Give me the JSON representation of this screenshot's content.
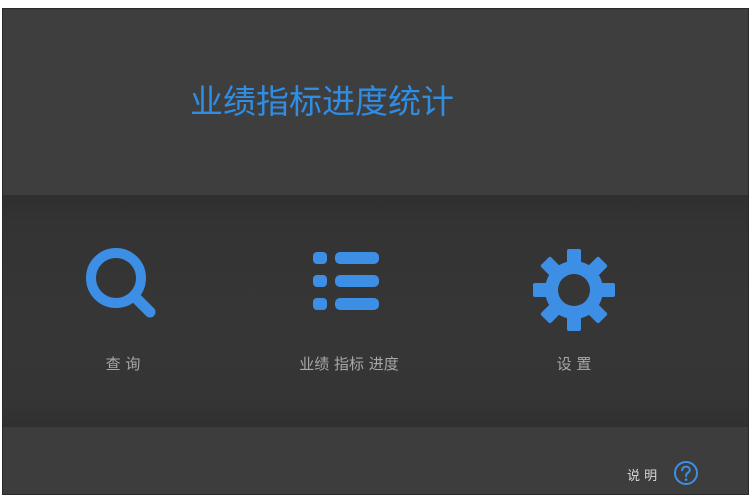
{
  "app": {
    "title": "业绩指标进度统计"
  },
  "menu": {
    "items": [
      {
        "label": "查  询",
        "icon": "search-icon"
      },
      {
        "label": "业绩 指标 进度",
        "icon": "list-icon"
      },
      {
        "label": "设  置",
        "icon": "gear-icon"
      }
    ]
  },
  "footer": {
    "help_label": "说 明",
    "help_icon": "question-circle-icon"
  },
  "colors": {
    "accent": "#2f8de4",
    "icon_blue": "#3d8fe6",
    "background": "#3d3d3d",
    "label_gray": "#a8a8a8"
  }
}
